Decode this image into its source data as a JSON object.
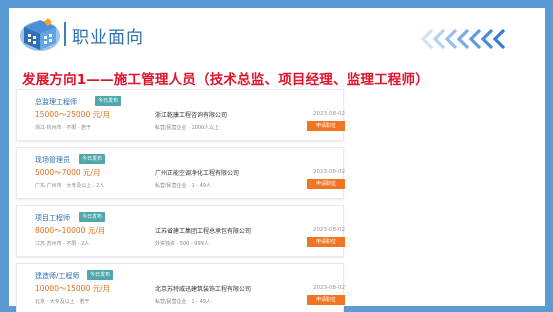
{
  "page": {
    "title": "职业面向",
    "headline": "发展方向1——施工管理人员（技术总监、项目经理、监理工程师）"
  },
  "colors": {
    "frame": "#5b9bd5",
    "title": "#2e6fb0",
    "headline": "#e0122b",
    "salary": "#e56d1b",
    "button": "#f07522",
    "tag": "#4fa7a9"
  },
  "icons": {
    "logo": "building-cube-icon",
    "decoration": "chevrons-left-icon"
  },
  "jobs": [
    {
      "title": "总监理工程师",
      "tag": "今日发布",
      "salary": "15000～25000 元/月",
      "meta": "浙江·杭州市 · 不限 · 若干",
      "company": "浙江乾康工程咨询有限公司",
      "info": "私营/民营企业 · 1000人以上",
      "date": "2023-08-02",
      "apply": "申请职位"
    },
    {
      "title": "现场管理员",
      "tag": "今日发布",
      "salary": "5000～7000 元/月",
      "meta": "广东·广州市 · 大专及以上 · 2人",
      "company": "广州正能空调净化工程有限公司",
      "info": "私营/民营企业 · 1 - 49人",
      "date": "2023-08-02",
      "apply": "申请职位"
    },
    {
      "title": "项目工程师",
      "tag": "今日发布",
      "salary": "8000～10000 元/月",
      "meta": "江苏·苏州市 · 不限 · 2人",
      "company": "江苏省建工集团工程总承包有限公司",
      "info": "外资独资 · 500 - 999人",
      "date": "2023-08-02",
      "apply": "申请职位"
    },
    {
      "title": "建造师/工程师",
      "tag": "今日发布",
      "salary": "10000～15000 元/月",
      "meta": "北京 · 大专及以上 · 若干",
      "company": "北京苏特威迅建筑装饰工程有限公司",
      "info": "私营/民营企业 · 1 - 49人",
      "date": "2023-08-02",
      "apply": "申请职位"
    }
  ]
}
